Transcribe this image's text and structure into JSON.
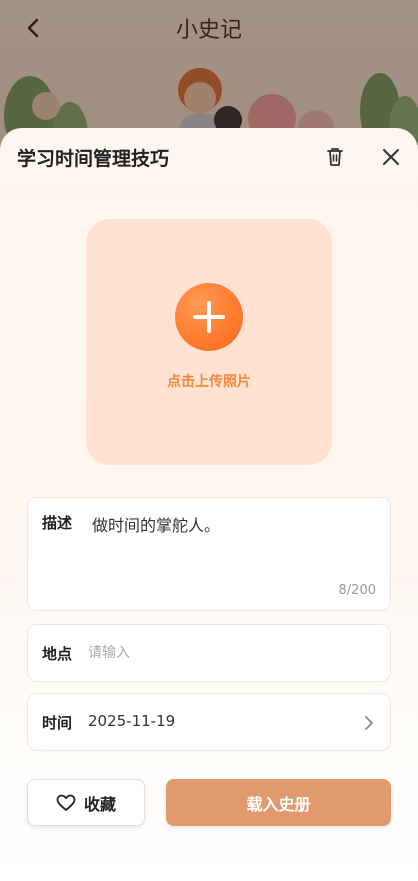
{
  "background": {
    "title": "小史记",
    "icons": {
      "back": "chevron-left-icon"
    }
  },
  "sheet": {
    "title": "学习时间管理技巧",
    "icons": {
      "delete": "trash-icon",
      "close": "close-icon"
    },
    "upload": {
      "label": "点击上传照片",
      "icon": "plus-icon"
    },
    "description": {
      "label": "描述",
      "value": "做时间的掌舵人。",
      "count": "8/200"
    },
    "location": {
      "label": "地点",
      "placeholder": "请输入",
      "value": ""
    },
    "time": {
      "label": "时间",
      "value": "2025-11-19",
      "icon": "chevron-right-icon"
    },
    "actions": {
      "favorite_label": "收藏",
      "favorite_icon": "heart-outline-icon",
      "load_label": "载入史册"
    }
  },
  "colors": {
    "accent": "#f28a3a",
    "upload_bg": "#ffe2d1",
    "primary_button": "#e09a6d"
  }
}
